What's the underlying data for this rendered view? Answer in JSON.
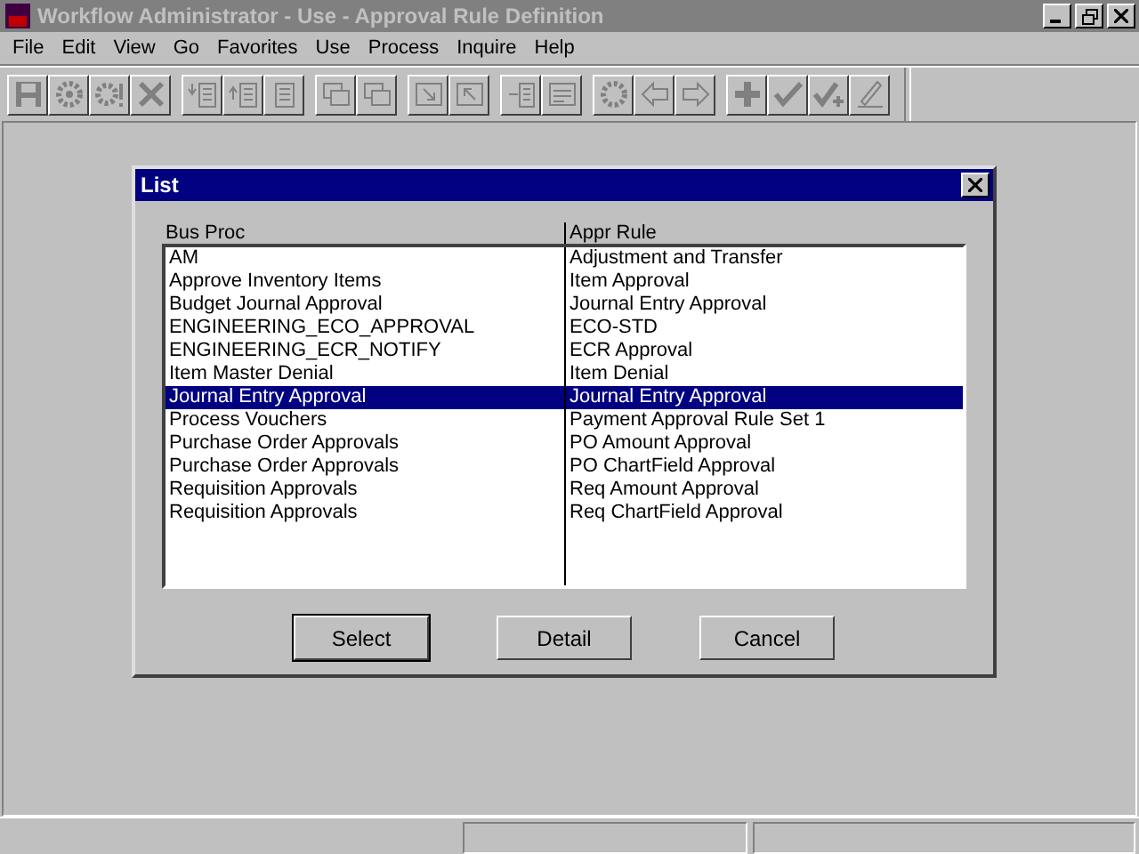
{
  "window": {
    "title": "Workflow Administrator - Use - Approval Rule Definition"
  },
  "menu": [
    "File",
    "Edit",
    "View",
    "Go",
    "Favorites",
    "Use",
    "Process",
    "Inquire",
    "Help"
  ],
  "dialog": {
    "title": "List",
    "columns": [
      "Bus Proc",
      "Appr Rule"
    ],
    "rows": [
      {
        "bus_proc": "AM",
        "appr_rule": "Adjustment and Transfer",
        "selected": false
      },
      {
        "bus_proc": "Approve Inventory Items",
        "appr_rule": "Item Approval",
        "selected": false
      },
      {
        "bus_proc": "Budget Journal Approval",
        "appr_rule": "Journal Entry Approval",
        "selected": false
      },
      {
        "bus_proc": "ENGINEERING_ECO_APPROVAL",
        "appr_rule": "ECO-STD",
        "selected": false
      },
      {
        "bus_proc": "ENGINEERING_ECR_NOTIFY",
        "appr_rule": "ECR Approval",
        "selected": false
      },
      {
        "bus_proc": "Item Master Denial",
        "appr_rule": "Item Denial",
        "selected": false
      },
      {
        "bus_proc": "Journal Entry Approval",
        "appr_rule": "Journal Entry Approval",
        "selected": true
      },
      {
        "bus_proc": "Process Vouchers",
        "appr_rule": "Payment Approval Rule Set 1",
        "selected": false
      },
      {
        "bus_proc": "Purchase Order Approvals",
        "appr_rule": "PO Amount Approval",
        "selected": false
      },
      {
        "bus_proc": "Purchase Order Approvals",
        "appr_rule": "PO ChartField Approval",
        "selected": false
      },
      {
        "bus_proc": "Requisition Approvals",
        "appr_rule": "Req Amount Approval",
        "selected": false
      },
      {
        "bus_proc": "Requisition Approvals",
        "appr_rule": "Req ChartField Approval",
        "selected": false
      }
    ],
    "buttons": [
      {
        "label": "Select",
        "default": true
      },
      {
        "label": "Detail",
        "default": false
      },
      {
        "label": "Cancel",
        "default": false
      }
    ]
  }
}
